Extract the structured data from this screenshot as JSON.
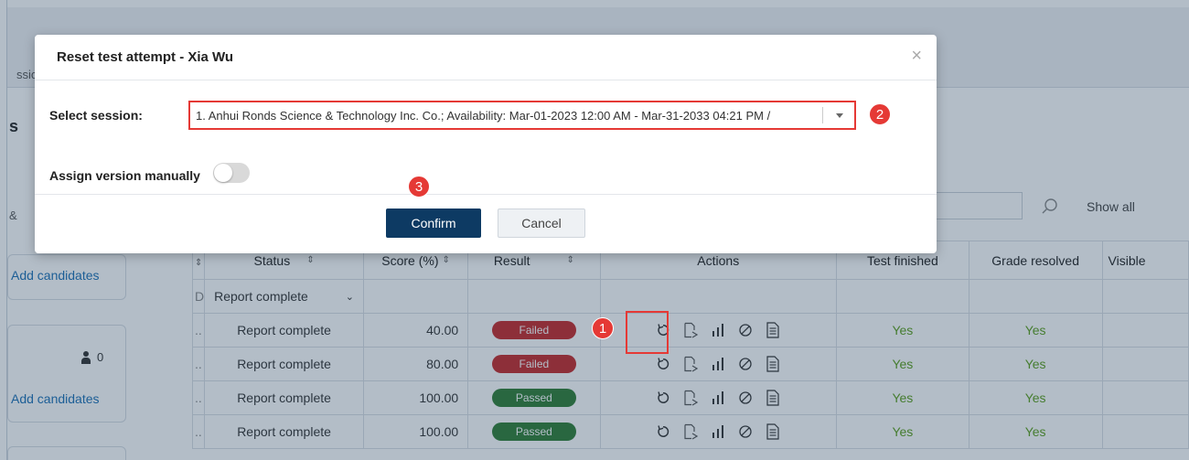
{
  "background": {
    "tab_fragment": "ssion",
    "heading_fragment": "s",
    "amp_fragment": "&",
    "cards": {
      "add_candidates_1": "Add candidates",
      "candidate_count": "0",
      "add_candidates_2": "Add candidates"
    },
    "toolbar": {
      "show_all": "Show all"
    },
    "table": {
      "headers": {
        "status": "Status",
        "score": "Score (%)",
        "result": "Result",
        "actions": "Actions",
        "test_finished": "Test finished",
        "grade_resolved": "Grade resolved",
        "visible": "Visible"
      },
      "filter_status": "Report complete",
      "rows": [
        {
          "status": "Report complete",
          "score": "40.00",
          "result": "Failed",
          "test_finished": "Yes",
          "grade_resolved": "Yes"
        },
        {
          "status": "Report complete",
          "score": "80.00",
          "result": "Failed",
          "test_finished": "Yes",
          "grade_resolved": "Yes"
        },
        {
          "status": "Report complete",
          "score": "100.00",
          "result": "Passed",
          "test_finished": "Yes",
          "grade_resolved": "Yes"
        },
        {
          "status": "Report complete",
          "score": "100.00",
          "result": "Passed",
          "test_finished": "Yes",
          "grade_resolved": "Yes"
        }
      ],
      "action_icons": [
        "reset-icon",
        "grade-icon",
        "stats-icon",
        "disable-icon",
        "report-icon"
      ]
    }
  },
  "modal": {
    "title": "Reset test attempt - Xia Wu",
    "close_glyph": "×",
    "select_session_label": "Select session:",
    "select_session_value": "1. Anhui Ronds Science & Technology Inc. Co.; Availability: Mar-01-2023 12:00 AM - Mar-31-2033 04:21 PM /",
    "assign_version_label": "Assign version manually",
    "assign_version_on": false,
    "confirm_label": "Confirm",
    "cancel_label": "Cancel"
  },
  "annotations": {
    "step1": "1",
    "step2": "2",
    "step3": "3"
  },
  "colors": {
    "accent_dark": "#0d3a63",
    "failed": "#c62828",
    "passed": "#2e7d32",
    "yes_text": "#5a9e1b",
    "annotation": "#e53935",
    "link": "#1a6fb5"
  }
}
